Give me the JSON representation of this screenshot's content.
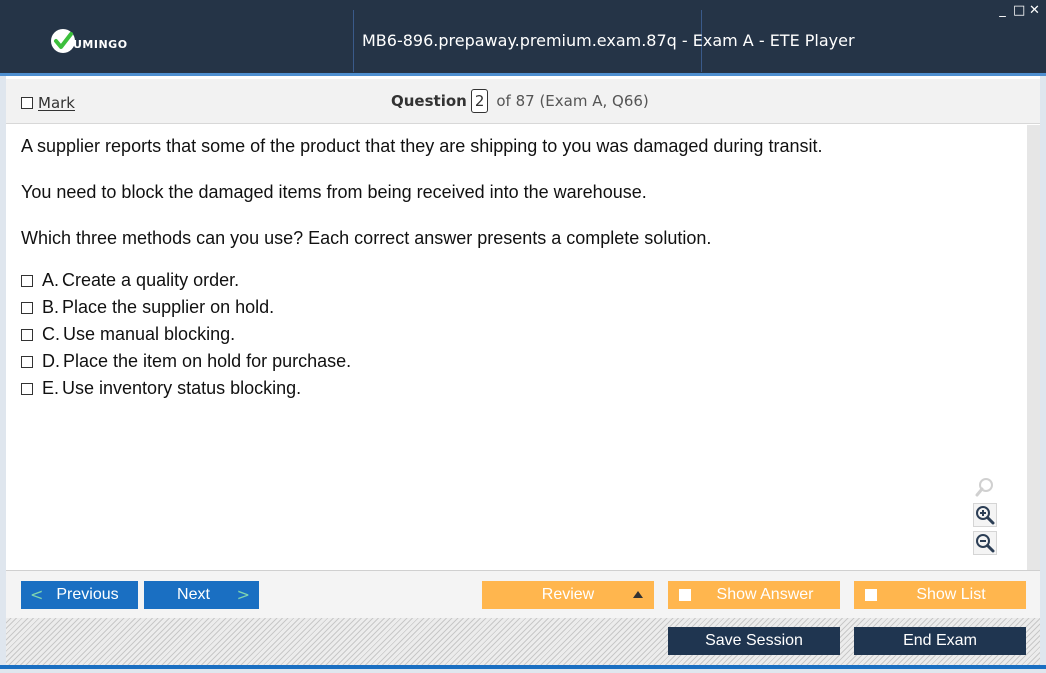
{
  "window": {
    "logo_text": "UMINGO",
    "title": "MB6-896.prepaway.premium.exam.87q - Exam A - ETE Player",
    "controls": {
      "minimize": "_",
      "maximize": "□",
      "close": "✕"
    }
  },
  "header": {
    "mark_label": "Mark",
    "question_label": "Question",
    "question_number": "2",
    "question_of": "of 87 (Exam A, Q66)"
  },
  "question": {
    "paragraphs": [
      "A supplier reports that some of the product that they are shipping to you was damaged during transit.",
      "You need to block the damaged items from being received into the warehouse.",
      "Which three methods can you use? Each correct answer presents a complete solution."
    ],
    "answers": [
      {
        "letter": "A.",
        "text": "Create a quality order."
      },
      {
        "letter": "B.",
        "text": "Place the supplier on hold."
      },
      {
        "letter": "C.",
        "text": "Use manual blocking."
      },
      {
        "letter": "D.",
        "text": "Place the item on hold for purchase."
      },
      {
        "letter": "E.",
        "text": "Use inventory status blocking."
      }
    ]
  },
  "icons": {
    "search": "search-icon",
    "zoom_in": "zoom-in-icon",
    "zoom_out": "zoom-out-icon"
  },
  "nav": {
    "previous": "Previous",
    "next": "Next",
    "review": "Review",
    "show_answer": "Show Answer",
    "show_list": "Show List"
  },
  "footer": {
    "save_session": "Save Session",
    "end_exam": "End Exam"
  },
  "colors": {
    "titlebar": "#253447",
    "accent_blue": "#1a6fc2",
    "orange": "#ffb64e",
    "navy": "#1f3550",
    "logo_green": "#3cbf3c"
  }
}
